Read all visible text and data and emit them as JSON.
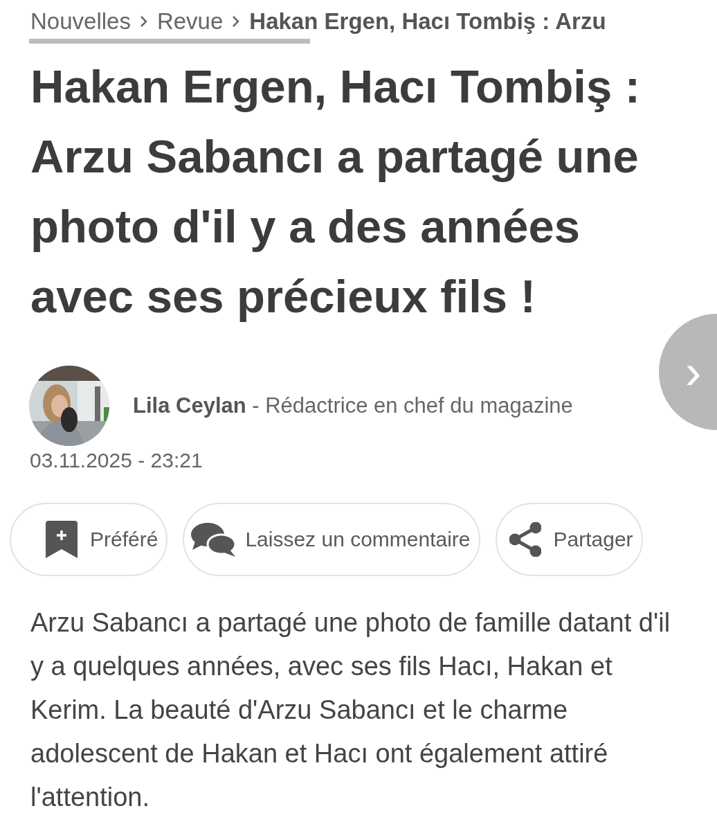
{
  "breadcrumb": [
    {
      "label": "Nouvelles",
      "current": false
    },
    {
      "label": "Revue",
      "current": false
    },
    {
      "label": "Hakan Ergen, Hacı Tombiş : Arzu",
      "current": true
    }
  ],
  "title": "Hakan Ergen, Hacı Tombiş : Arzu Sabancı a partagé une photo d'il y a des années avec ses précieux fils !",
  "next_button": {
    "label": "›"
  },
  "author": {
    "name": "Lila Ceylan",
    "role": " - Rédactrice en chef du magazine"
  },
  "date": "03.11.2025 - 23:21",
  "actions": [
    {
      "kind": "bookmark",
      "label": "Préféré"
    },
    {
      "kind": "comment",
      "label": "Laissez un commentaire"
    },
    {
      "kind": "share",
      "label": "Partager"
    }
  ],
  "body": "Arzu Sabancı a partagé une photo de famille datant d'il y a quelques années, avec ses fils Hacı, Hakan et Kerim. La beauté d'Arzu Sabancı et le charme adolescent de Hakan et Hacı ont également attiré l'attention."
}
